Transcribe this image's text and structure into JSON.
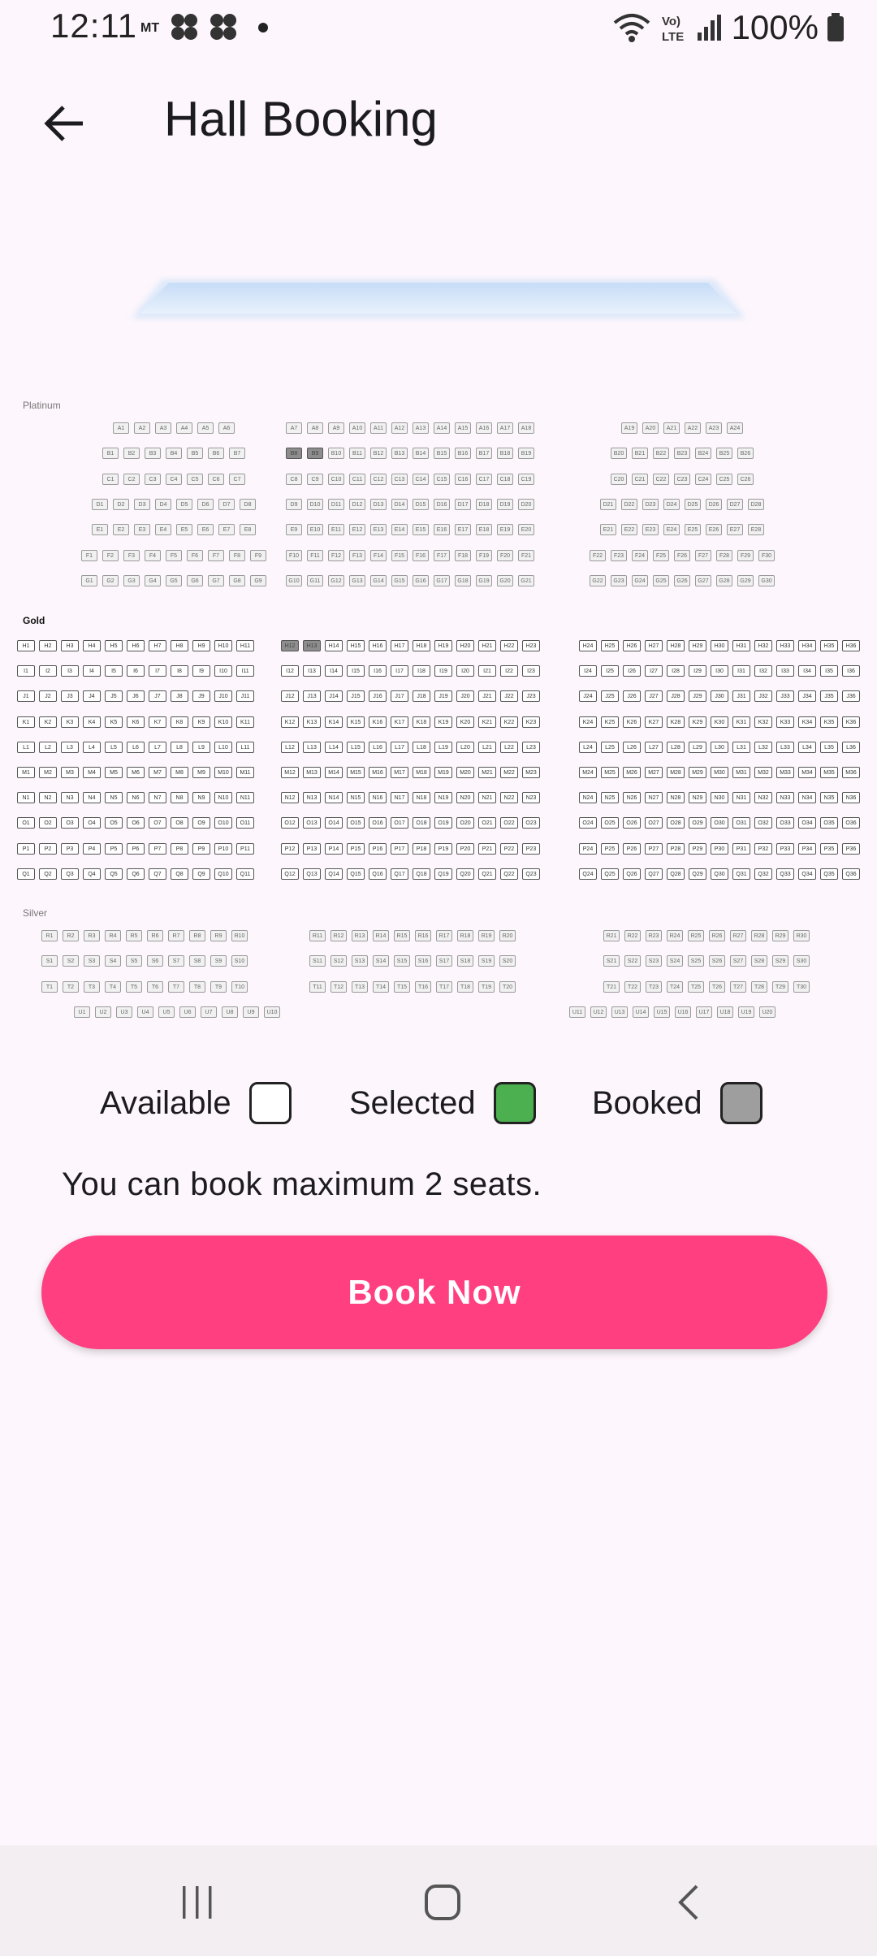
{
  "status_bar": {
    "time": "12:11",
    "carrier": "MT",
    "battery": "100%"
  },
  "app_bar": {
    "title": "Hall Booking",
    "back_icon": "arrow-back-icon"
  },
  "seat_map": {
    "sections": [
      {
        "name": "Platinum",
        "blocks": [
          {
            "rows": [
              {
                "row": "A",
                "from": 1,
                "to": 6
              },
              {
                "row": "B",
                "from": 1,
                "to": 7
              },
              {
                "row": "C",
                "from": 1,
                "to": 7
              },
              {
                "row": "D",
                "from": 1,
                "to": 8
              },
              {
                "row": "E",
                "from": 1,
                "to": 8
              },
              {
                "row": "F",
                "from": 1,
                "to": 9
              },
              {
                "row": "G",
                "from": 1,
                "to": 9
              }
            ]
          },
          {
            "rows": [
              {
                "row": "A",
                "from": 7,
                "to": 18
              },
              {
                "row": "B",
                "from": 8,
                "to": 19
              },
              {
                "row": "C",
                "from": 8,
                "to": 19
              },
              {
                "row": "D",
                "from": 9,
                "to": 20
              },
              {
                "row": "E",
                "from": 9,
                "to": 20
              },
              {
                "row": "F",
                "from": 10,
                "to": 21
              },
              {
                "row": "G",
                "from": 10,
                "to": 21
              }
            ]
          },
          {
            "rows": [
              {
                "row": "A",
                "from": 19,
                "to": 24
              },
              {
                "row": "B",
                "from": 20,
                "to": 26
              },
              {
                "row": "C",
                "from": 20,
                "to": 26
              },
              {
                "row": "D",
                "from": 21,
                "to": 28
              },
              {
                "row": "E",
                "from": 21,
                "to": 28
              },
              {
                "row": "F",
                "from": 22,
                "to": 30
              },
              {
                "row": "G",
                "from": 22,
                "to": 30
              }
            ]
          }
        ]
      },
      {
        "name": "Gold",
        "blocks": [
          {
            "rows": [
              {
                "row": "H",
                "from": 1,
                "to": 11
              },
              {
                "row": "I",
                "from": 1,
                "to": 11
              },
              {
                "row": "J",
                "from": 1,
                "to": 11
              },
              {
                "row": "K",
                "from": 1,
                "to": 11
              },
              {
                "row": "L",
                "from": 1,
                "to": 11
              },
              {
                "row": "M",
                "from": 1,
                "to": 11
              },
              {
                "row": "N",
                "from": 1,
                "to": 11
              },
              {
                "row": "O",
                "from": 1,
                "to": 11
              },
              {
                "row": "P",
                "from": 1,
                "to": 11
              },
              {
                "row": "Q",
                "from": 1,
                "to": 11
              }
            ]
          },
          {
            "rows": [
              {
                "row": "H",
                "from": 12,
                "to": 23
              },
              {
                "row": "I",
                "from": 12,
                "to": 23
              },
              {
                "row": "J",
                "from": 12,
                "to": 23
              },
              {
                "row": "K",
                "from": 12,
                "to": 23
              },
              {
                "row": "L",
                "from": 12,
                "to": 23
              },
              {
                "row": "M",
                "from": 12,
                "to": 23
              },
              {
                "row": "N",
                "from": 12,
                "to": 23
              },
              {
                "row": "O",
                "from": 12,
                "to": 23
              },
              {
                "row": "P",
                "from": 12,
                "to": 23
              },
              {
                "row": "Q",
                "from": 12,
                "to": 23
              }
            ]
          },
          {
            "rows": [
              {
                "row": "H",
                "from": 24,
                "to": 36
              },
              {
                "row": "I",
                "from": 24,
                "to": 36
              },
              {
                "row": "J",
                "from": 24,
                "to": 36
              },
              {
                "row": "K",
                "from": 24,
                "to": 36
              },
              {
                "row": "L",
                "from": 24,
                "to": 36
              },
              {
                "row": "M",
                "from": 24,
                "to": 36
              },
              {
                "row": "N",
                "from": 24,
                "to": 36
              },
              {
                "row": "O",
                "from": 24,
                "to": 36
              },
              {
                "row": "P",
                "from": 24,
                "to": 36
              },
              {
                "row": "Q",
                "from": 24,
                "to": 36
              }
            ]
          }
        ]
      },
      {
        "name": "Silver",
        "blocks": [
          {
            "rows": [
              {
                "row": "R",
                "from": 1,
                "to": 10
              },
              {
                "row": "S",
                "from": 1,
                "to": 10
              },
              {
                "row": "T",
                "from": 1,
                "to": 10
              },
              {
                "row": "U",
                "from": 1,
                "to": 10
              }
            ]
          },
          {
            "rows": [
              {
                "row": "R",
                "from": 11,
                "to": 20
              },
              {
                "row": "S",
                "from": 11,
                "to": 20
              },
              {
                "row": "T",
                "from": 11,
                "to": 20
              }
            ]
          },
          {
            "rows": [
              {
                "row": "R",
                "from": 21,
                "to": 30
              },
              {
                "row": "S",
                "from": 21,
                "to": 30
              },
              {
                "row": "T",
                "from": 21,
                "to": 30
              },
              {
                "row": "U",
                "from": 11,
                "to": 20
              }
            ]
          }
        ]
      }
    ],
    "booked_seats": [
      "B8",
      "B9",
      "H12",
      "H13"
    ],
    "selected_seats": []
  },
  "legend": {
    "available": {
      "label": "Available",
      "color": "#ffffff"
    },
    "selected": {
      "label": "Selected",
      "color": "#4caf50"
    },
    "booked": {
      "label": "Booked",
      "color": "#9e9e9e"
    }
  },
  "info_text": "You can book maximum 2 seats.",
  "book_button": {
    "label": "Book Now",
    "color": "#ff3f80"
  },
  "nav_bar": {
    "recents_icon": "recent-apps-icon",
    "home_icon": "home-icon",
    "back_icon": "back-chevron-icon"
  }
}
